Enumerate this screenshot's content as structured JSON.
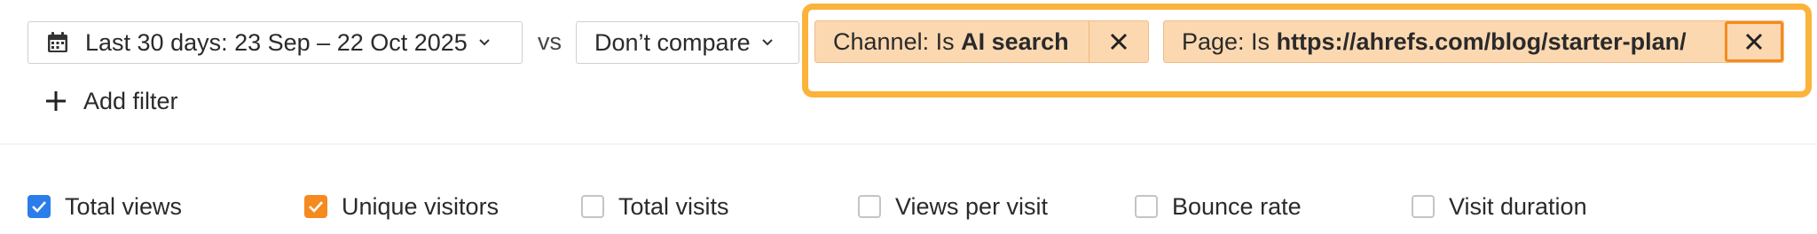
{
  "date_range": {
    "label": "Last 30 days: 23 Sep – 22 Oct 2025",
    "icon": "calendar-icon"
  },
  "vs_label": "vs",
  "compare": {
    "label": "Don’t compare",
    "icon": "chevron-down-icon"
  },
  "filters": [
    {
      "prefix": "Channel: Is ",
      "value": "AI search"
    },
    {
      "prefix": "Page: Is ",
      "value": "https://ahrefs.com/blog/starter-plan/"
    }
  ],
  "add_filter": {
    "label": "Add filter",
    "icon": "plus-icon"
  },
  "metrics": [
    {
      "label": "Total views",
      "checked": true,
      "color": "#2b7de9"
    },
    {
      "label": "Unique visitors",
      "checked": true,
      "color": "#f58a1f"
    },
    {
      "label": "Total visits",
      "checked": false
    },
    {
      "label": "Views per visit",
      "checked": false
    },
    {
      "label": "Bounce rate",
      "checked": false
    },
    {
      "label": "Visit duration",
      "checked": false
    }
  ],
  "colors": {
    "highlight": "#fbb33b",
    "chip_bg": "#fcd8b0",
    "active_close_border": "#f58a1f"
  }
}
